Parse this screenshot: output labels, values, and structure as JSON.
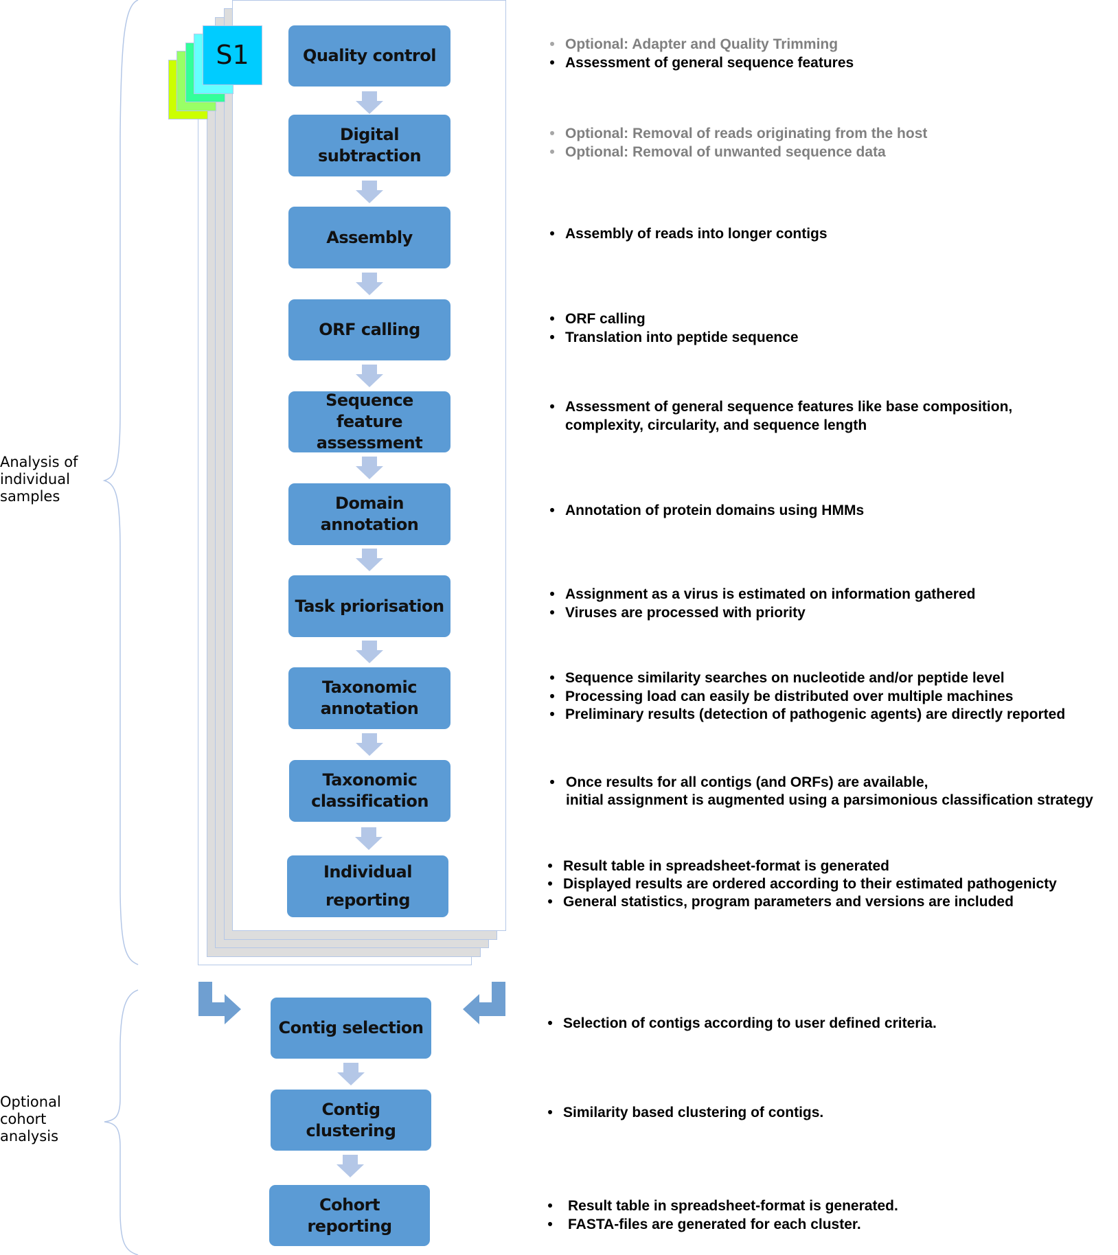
{
  "sections": {
    "individual": "Analysis of individual samples",
    "cohort": "Optional cohort analysis"
  },
  "sample_stack": {
    "label": "S1",
    "colors": [
      "#ccff00",
      "#99ff66",
      "#33ff99",
      "#66ffff",
      "#00ccff"
    ]
  },
  "colors": {
    "step_fill": "#5b9bd5",
    "arrow_fill": "#b4c7e7",
    "corner_arrow_fill": "#6f9fd1",
    "muted_text": "#808080",
    "brace": "#b4c7e7"
  },
  "steps": [
    {
      "label": "Quality control",
      "bullets": [
        {
          "text": "Optional: Adapter and Quality Trimming",
          "optional": true
        },
        {
          "text": "Assessment of general sequence features",
          "optional": false
        }
      ]
    },
    {
      "label": "Digital subtraction",
      "bullets": [
        {
          "text": "Optional: Removal of reads originating from the host",
          "optional": true
        },
        {
          "text": "Optional: Removal of unwanted sequence data",
          "optional": true
        }
      ]
    },
    {
      "label": "Assembly",
      "bullets": [
        {
          "text": "Assembly of reads into longer contigs",
          "optional": false
        }
      ]
    },
    {
      "label": "ORF calling",
      "bullets": [
        {
          "text": "ORF calling",
          "optional": false
        },
        {
          "text": "Translation into peptide sequence",
          "optional": false
        }
      ]
    },
    {
      "label": "Sequence feature assessment",
      "bullets": [
        {
          "text": "Assessment of general sequence features like base composition,",
          "optional": false
        },
        {
          "text": "complexity, circularity, and sequence length",
          "optional": false,
          "continuation": true
        }
      ]
    },
    {
      "label": "Domain annotation",
      "bullets": [
        {
          "text": "Annotation of protein domains using HMMs",
          "optional": false
        }
      ]
    },
    {
      "label": "Task priorisation",
      "bullets": [
        {
          "text": "Assignment as a virus is estimated on information gathered",
          "optional": false
        },
        {
          "text": "Viruses are processed with priority",
          "optional": false
        }
      ]
    },
    {
      "label": "Taxonomic annotation",
      "bullets": [
        {
          "text": "Sequence similarity searches on nucleotide and/or peptide level",
          "optional": false
        },
        {
          "text": "Processing load can easily be distributed over multiple machines",
          "optional": false
        },
        {
          "text": "Preliminary results (detection of pathogenic agents) are directly reported",
          "optional": false
        }
      ]
    },
    {
      "label": "Taxonomic classification",
      "bullets": [
        {
          "text": "Once results for all contigs (and ORFs) are available,",
          "optional": false
        },
        {
          "text": "initial assignment is augmented using a parsimonious classification strategy",
          "optional": false,
          "continuation": true
        }
      ]
    },
    {
      "label": "Individual reporting",
      "bullets": [
        {
          "text": "Result table in spreadsheet-format is generated",
          "optional": false
        },
        {
          "text": "Displayed results are ordered according to their estimated pathogenicty",
          "optional": false
        },
        {
          "text": "General statistics, program parameters and versions are included",
          "optional": false
        }
      ]
    }
  ],
  "cohort_steps": [
    {
      "label": "Contig selection",
      "bullets": [
        {
          "text": "Selection of contigs according to user defined criteria.",
          "optional": false
        }
      ]
    },
    {
      "label": "Contig clustering",
      "bullets": [
        {
          "text": "Similarity based clustering of contigs.",
          "optional": false
        }
      ]
    },
    {
      "label": "Cohort reporting",
      "bullets": [
        {
          "text": "Result table in spreadsheet-format is generated.",
          "optional": false
        },
        {
          "text": "FASTA-files are generated for each cluster.",
          "optional": false
        }
      ]
    }
  ],
  "bullet_glyph": "•"
}
